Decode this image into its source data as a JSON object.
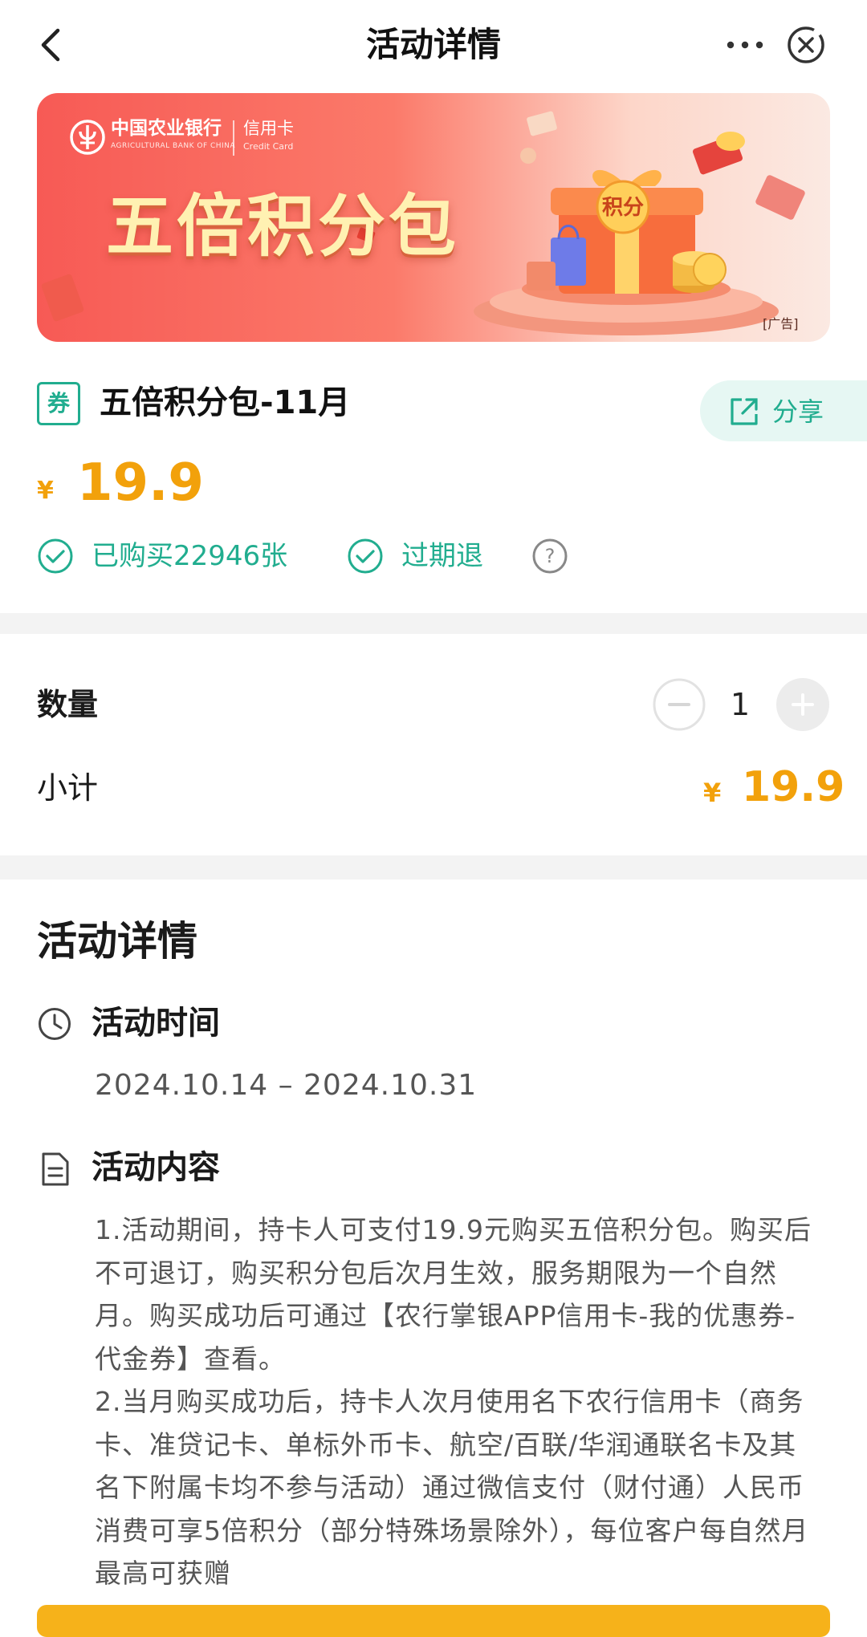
{
  "header": {
    "title": "活动详情",
    "icons": [
      "chevron-left-icon",
      "more-icon",
      "close-icon"
    ]
  },
  "banner": {
    "bank_name": "中国农业银行",
    "bank_name_en": "AGRICULTURAL BANK OF CHINA",
    "card_type": "信用卡",
    "card_type_en": "Credit Card",
    "title": "五倍积分包",
    "gift_label": "积分",
    "ad_badge": "[广告]"
  },
  "product": {
    "coupon_badge": "券",
    "name": "五倍积分包-11月",
    "share_label": "分享",
    "currency": "¥",
    "price": "19.9",
    "bought": "已购买22946张",
    "expire_refund": "过期退",
    "help": "?"
  },
  "order": {
    "quantity_label": "数量",
    "quantity": "1",
    "subtotal_label": "小计",
    "currency": "¥",
    "subtotal": "19.9"
  },
  "details": {
    "title": "活动详情",
    "time_label": "活动时间",
    "time_value": "2024.10.14 – 2024.10.31",
    "content_label": "活动内容",
    "content_p1": "1.活动期间，持卡人可支付19.9元购买五倍积分包。购买后不可退订，购买积分包后次月生效，服务期限为一个自然月。购买成功后可通过【农行掌银APP信用卡-我的优惠券-代金券】查看。",
    "content_p2": "2.当月购买成功后，持卡人次月使用名下农行信用卡（商务卡、准贷记卡、单标外币卡、航空/百联/华润通联名卡及其名下附属卡均不参与活动）通过微信支付（财付通）人民币消费可享5倍积分（部分特殊场景除外），每位客户每自然月最高可获赠"
  },
  "colors": {
    "brand_green": "#21ad8f",
    "price_orange": "#f2a10b",
    "banner_red": "#f75a55"
  }
}
